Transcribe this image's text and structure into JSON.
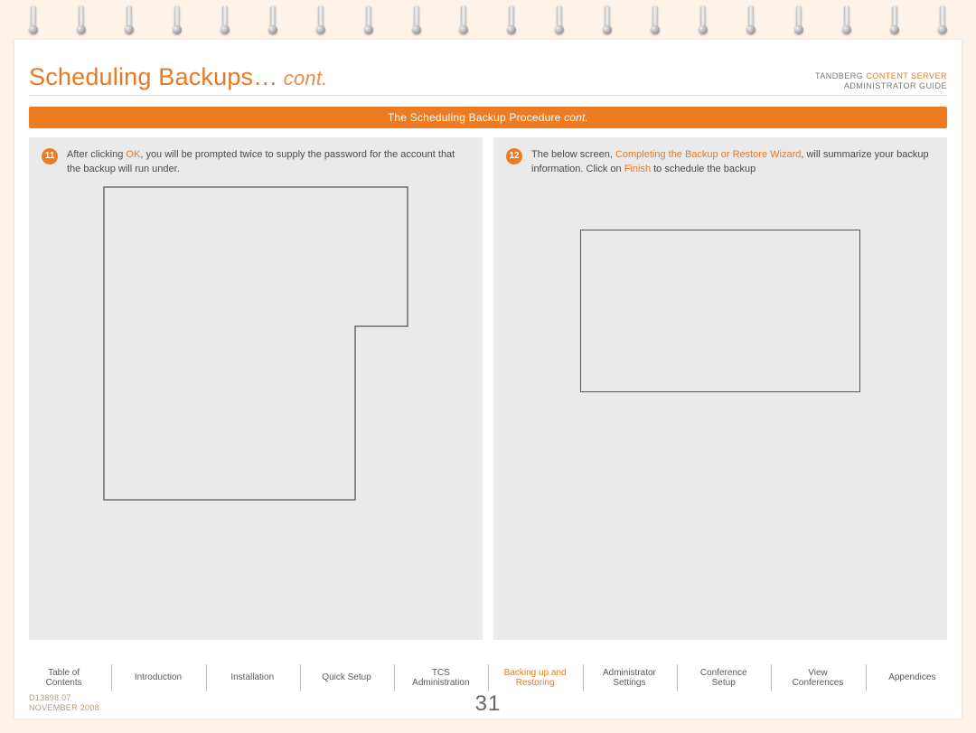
{
  "header": {
    "title_main": "Scheduling Backups…",
    "title_cont": " cont.",
    "brand_prefix": "TANDBERG ",
    "brand_orange": "CONTENT SERVER",
    "brand_sub": "ADMINISTRATOR GUIDE"
  },
  "section_bar": {
    "text": "The Scheduling Backup Procedure ",
    "cont": "cont."
  },
  "step11": {
    "num": "11",
    "pre": "After clicking ",
    "ok": "OK",
    "post": ", you will be prompted twice to supply the password for the account that the backup will run under."
  },
  "step12": {
    "num": "12",
    "pre": "The below screen, ",
    "hl": "Completing the Backup or Restore Wizard",
    "mid": ", will summarize your backup information. Click on ",
    "fin": "Finish",
    "post": " to schedule the backup"
  },
  "tabs": [
    {
      "l1": "Table of",
      "l2": "Contents"
    },
    {
      "l1": "Introduction",
      "l2": ""
    },
    {
      "l1": "Installation",
      "l2": ""
    },
    {
      "l1": "Quick Setup",
      "l2": ""
    },
    {
      "l1": "TCS",
      "l2": "Administration"
    },
    {
      "l1": "Backing up and",
      "l2": "Restoring"
    },
    {
      "l1": "Administrator",
      "l2": "Settings"
    },
    {
      "l1": "Conference",
      "l2": "Setup"
    },
    {
      "l1": "View",
      "l2": "Conferences"
    },
    {
      "l1": "Appendices",
      "l2": ""
    }
  ],
  "active_tab_index": 5,
  "footer": {
    "doc": "D13898.07",
    "date": "NOVEMBER 2008",
    "page": "31"
  }
}
